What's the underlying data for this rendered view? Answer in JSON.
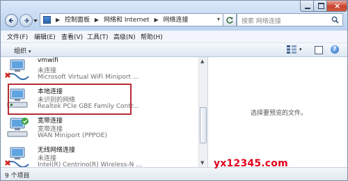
{
  "address": {
    "crumbs": [
      "控制面板",
      "网络和 Internet",
      "网络连接"
    ],
    "sep": "▶",
    "dropdown": "▾"
  },
  "search": {
    "placeholder": "搜索 网络连接"
  },
  "window_controls": {
    "close": "×"
  },
  "menu": [
    "文件(F)",
    "编辑(E)",
    "查看(V)",
    "工具(T)",
    "高级(N)",
    "帮助(H)"
  ],
  "toolbar": {
    "organize": "组织",
    "dropdown": "▾",
    "help": "?"
  },
  "connections": [
    {
      "name": "vmwifi",
      "status": "未连接",
      "device": "Microsoft Virtual WiFi Miniport ...",
      "state": "disconnected"
    },
    {
      "name": "本地连接",
      "status": "未识别的网络",
      "device": "Realtek PCIe GBE Family Contr...",
      "state": "connected"
    },
    {
      "name": "宽带连接",
      "status": "宽带连接",
      "device": "WAN Miniport (PPPOE)",
      "state": "broadband"
    },
    {
      "name": "无线网络连接",
      "status": "未连接",
      "device": "Intel(R) Centrino(R) Wireless-N ...",
      "state": "disconnected"
    }
  ],
  "preview": {
    "message": "选择要预览的文件。"
  },
  "status_bar": {
    "count": "9 个项目"
  },
  "scrollbar": {
    "up": "▲",
    "down": "▼"
  },
  "watermark": "yx12345.com",
  "colors": {
    "highlight_border": "#b82c33",
    "watermark": "#e2001a"
  }
}
